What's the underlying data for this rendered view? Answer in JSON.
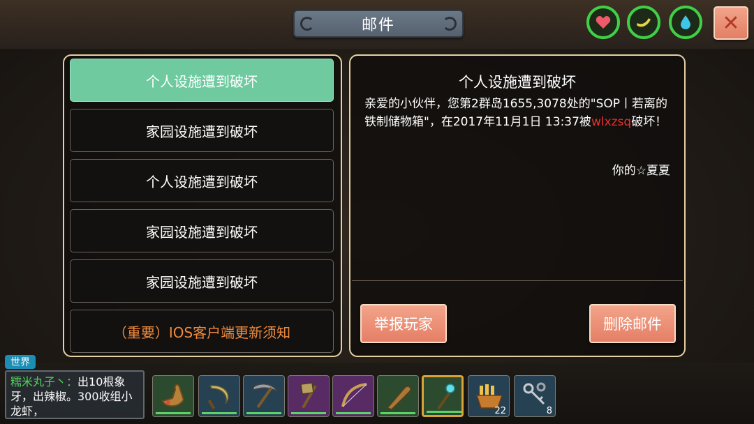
{
  "header": {
    "title": "邮件",
    "status_icons": [
      {
        "name": "heart-icon",
        "color": "#40d047"
      },
      {
        "name": "hunger-icon",
        "color": "#40d047"
      },
      {
        "name": "water-drop-icon",
        "color": "#40d047"
      }
    ],
    "close_label": "✕"
  },
  "mail_list": [
    {
      "subject": "个人设施遭到破坏",
      "selected": true
    },
    {
      "subject": "家园设施遭到破坏"
    },
    {
      "subject": "个人设施遭到破坏"
    },
    {
      "subject": "家园设施遭到破坏"
    },
    {
      "subject": "家园设施遭到破坏"
    },
    {
      "subject": "（重要）IOS客户端更新须知",
      "important": true
    }
  ],
  "detail": {
    "title": "个人设施遭到破坏",
    "body_prefix": "亲爱的小伙伴，您第2群岛1655,3078处的\"SOP丨若离的铁制储物箱\"，在2017年11月1日 13:37被",
    "attacker": "wlxzsq",
    "body_suffix": "破坏！",
    "signature": "你的☆夏夏",
    "report_label": "举报玩家",
    "delete_label": "删除邮件"
  },
  "chat": {
    "channel": "世界",
    "sender": "糯米丸子丶：",
    "message": "出10根象牙，出辣椒。300收组小龙虾，"
  },
  "hotbar": [
    {
      "icon": "pouch-icon"
    },
    {
      "icon": "sickle-icon"
    },
    {
      "icon": "pickaxe-icon"
    },
    {
      "icon": "axe-icon"
    },
    {
      "icon": "bow-icon"
    },
    {
      "icon": "club-icon"
    },
    {
      "icon": "staff-icon",
      "selected": true
    },
    {
      "icon": "fries-icon",
      "count": "22"
    },
    {
      "icon": "keys-icon",
      "count": "8"
    }
  ],
  "colors": {
    "accent_green": "#6fcaa0",
    "button_salmon": "#e57f66",
    "highlight_red": "#e8312a",
    "important_orange": "#f08a3c"
  }
}
